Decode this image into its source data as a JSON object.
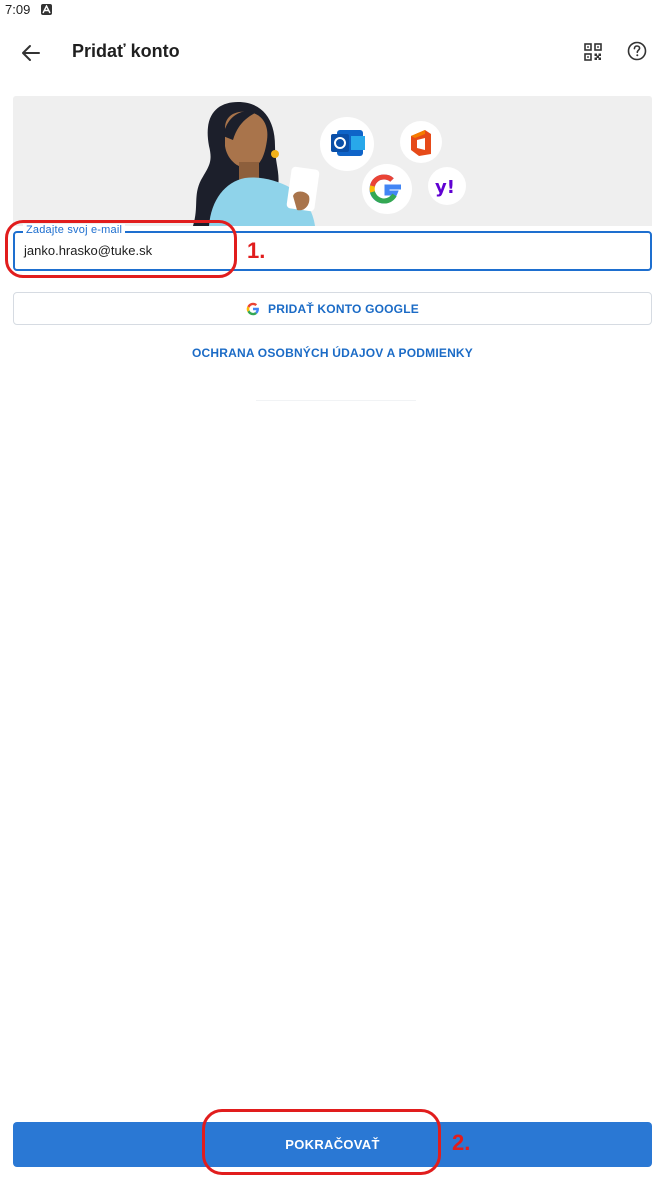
{
  "status_bar": {
    "time": "7:09",
    "notification_icon": "android-a-icon"
  },
  "app_bar": {
    "title": "Pridať konto",
    "back_icon": "arrow-left-icon",
    "qr_icon": "qr-code-icon",
    "help_icon": "help-circle-icon"
  },
  "banner": {
    "illustration": "woman-with-phone",
    "provider_icons": [
      "outlook-icon",
      "office-icon",
      "google-icon",
      "yahoo-icon"
    ],
    "yahoo_text": "y!"
  },
  "email_field": {
    "label": "Zadajte svoj e-mail",
    "value": "janko.hrasko@tuke.sk"
  },
  "google_button": {
    "label": "PRIDAŤ KONTO GOOGLE",
    "icon": "google-g-icon"
  },
  "privacy_link": {
    "label": "OCHRANA OSOBNÝCH ÚDAJOV A PODMIENKY"
  },
  "continue_button": {
    "label": "POKRAČOVAŤ"
  },
  "annotations": [
    {
      "number": "1."
    },
    {
      "number": "2."
    }
  ],
  "colors": {
    "accent": "#2a78d4",
    "link": "#1b6bc6",
    "annotation": "#e11d1d",
    "banner_bg": "#efefef"
  }
}
